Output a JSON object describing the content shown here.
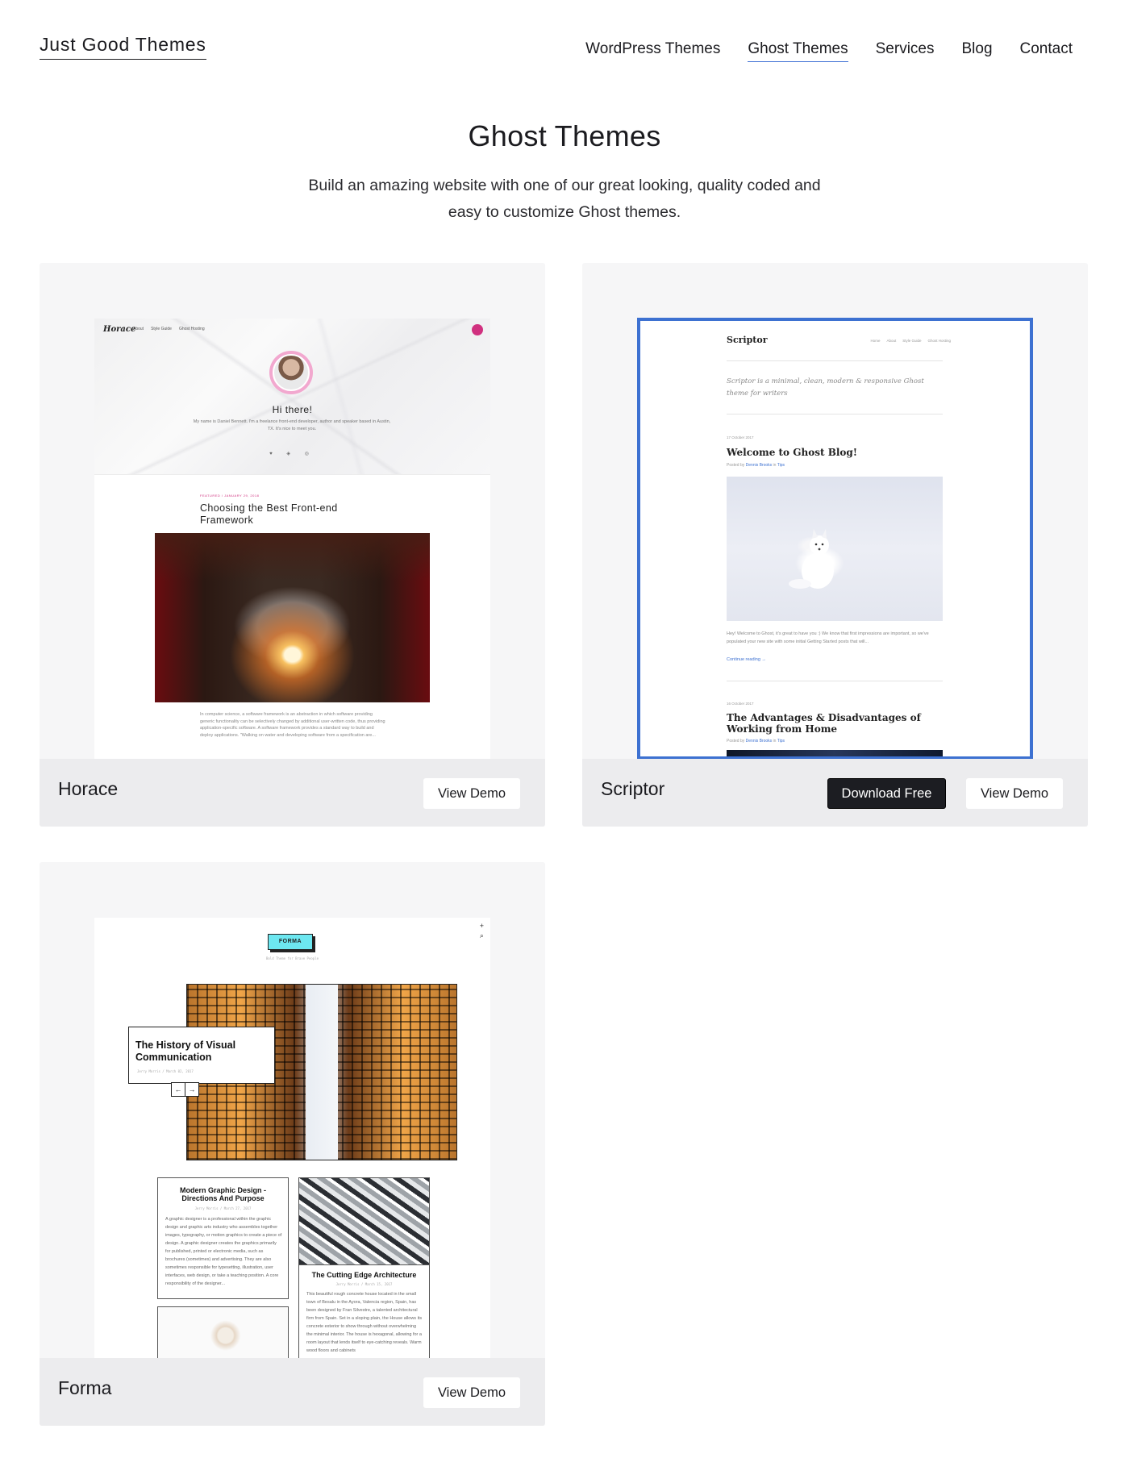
{
  "site": {
    "logo": "Just Good Themes",
    "nav": [
      "WordPress Themes",
      "Ghost Themes",
      "Services",
      "Blog",
      "Contact"
    ],
    "active_nav": "Ghost Themes",
    "accent_color": "#3d6fd4"
  },
  "hero": {
    "title": "Ghost Themes",
    "intro_line1": "Build an amazing website with one of our great looking, quality coded and",
    "intro_line2": "easy to customize Ghost themes."
  },
  "themes": [
    {
      "name": "Horace",
      "view_demo": "View Demo",
      "preview": {
        "logo": "Horace",
        "menu": [
          "About",
          "Style Guide",
          "Ghost Hosting"
        ],
        "greeting": "Hi there!",
        "bio": "My name is Daniel Bennett. I'm a freelance front-end developer, author and speaker based in Austin, TX. It's nice to meet you.",
        "meta": "FEATURED / JANUARY 29, 2018",
        "post_title": "Choosing the Best Front-end Framework",
        "excerpt": "In computer science, a software framework is an abstraction in which software providing generic functionality can be selectively changed by additional user-written code, thus providing application-specific software. A software framework provides a standard way to build and deploy applications. \"Walking on water and developing software from a specification are...",
        "social": "♥ ◈ ◎"
      }
    },
    {
      "name": "Scriptor",
      "download": "Download Free",
      "view_demo": "View Demo",
      "preview": {
        "brand": "Scriptor",
        "menu": [
          "Home",
          "About",
          "Style Guide",
          "Ghost Hosting"
        ],
        "tagline": "Scriptor is a minimal, clean, modern & responsive Ghost theme for writers",
        "post1_date": "17 October 2017",
        "post1_title": "Welcome to Ghost Blog!",
        "post1_by": "Posted by",
        "post1_author": "Dennis Brooks",
        "post1_in": "in",
        "post1_tag": "Tips",
        "post1_excerpt": "Hey! Welcome to Ghost, it's great to have you :) We know that first impressions are important, so we've populated your new site with some initial Getting Started posts that will...",
        "post1_more": "Continue reading →",
        "post2_date": "16 October 2017",
        "post2_title": "The Advantages & Disadvantages of Working from Home",
        "post2_author": "Dennis Brooks",
        "post2_tag": "Tips"
      }
    },
    {
      "name": "Forma",
      "view_demo": "View Demo",
      "preview": {
        "logo": "FORMA",
        "tagline": "Bold Theme for Brave People",
        "featured_title": "The History of Visual Communication",
        "featured_meta": "Jerry Morris / March 02, 2017",
        "post1_title": "Modern Graphic Design - Directions And Purpose",
        "post1_meta": "Jerry Morris / March 27, 2017",
        "post1_body": "A graphic designer is a professional within the graphic design and graphic arts industry who assembles together images, typography, or motion graphics to create a piece of design. A graphic designer creates the graphics primarily for published, printed or electronic media, such as brochures (sometimes) and advertising. They are also sometimes responsible for typesetting, illustration, user interfaces, web design, or take a teaching position. A core responsibility of the designer...",
        "post2_title": "The Cutting Edge Architecture",
        "post2_meta": "Jerry Morris / March 15, 2017",
        "post2_body": "This beautiful rough concrete house located in the small town of Besalu in the Ayora, Valencia region, Spain, has been designed by Fran Silvestre, a talented architectural firm from Spain. Set in a sloping plain, the House allows its concrete exterior to show through without overwhelming the minimal interior. The house is hexagonal, allowing for a room layout that lends itself to eye-catching reveals. Warm wood floors and cabinets"
      }
    }
  ]
}
